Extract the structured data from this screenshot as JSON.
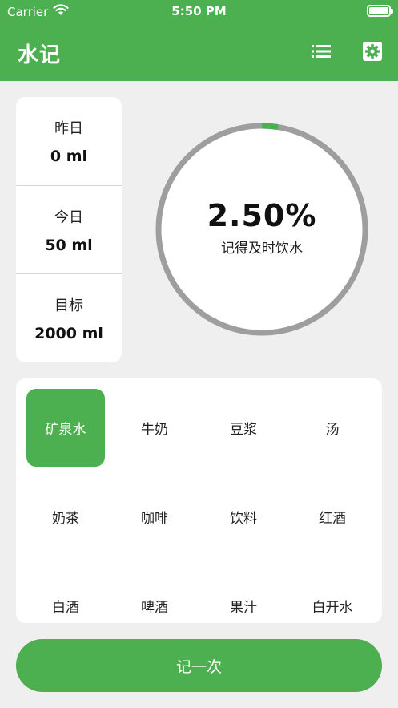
{
  "status_bar": {
    "carrier": "Carrier",
    "time": "5:50 PM"
  },
  "header": {
    "title": "水记",
    "icons": [
      "list-icon",
      "gear-icon"
    ]
  },
  "stats": [
    {
      "label": "昨日",
      "value": "0 ml"
    },
    {
      "label": "今日",
      "value": "50 ml"
    },
    {
      "label": "目标",
      "value": "2000 ml"
    }
  ],
  "progress": {
    "percent_text": "2.50%",
    "fraction": 0.025,
    "caption": "记得及时饮水"
  },
  "drinks": [
    {
      "label": "矿泉水",
      "selected": true
    },
    {
      "label": "牛奶",
      "selected": false
    },
    {
      "label": "豆浆",
      "selected": false
    },
    {
      "label": "汤",
      "selected": false
    },
    {
      "label": "奶茶",
      "selected": false
    },
    {
      "label": "咖啡",
      "selected": false
    },
    {
      "label": "饮料",
      "selected": false
    },
    {
      "label": "红酒",
      "selected": false
    },
    {
      "label": "白酒",
      "selected": false
    },
    {
      "label": "啤酒",
      "selected": false
    },
    {
      "label": "果汁",
      "selected": false
    },
    {
      "label": "白开水",
      "selected": false
    }
  ],
  "record_button": {
    "label": "记一次"
  },
  "colors": {
    "accent": "#4caf50",
    "ring_track": "#9e9e9e",
    "background": "#efefef"
  }
}
